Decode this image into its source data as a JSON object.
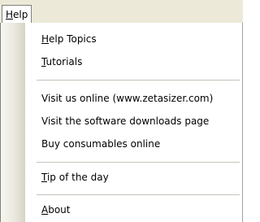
{
  "menu_bar": {
    "title_mnemonic": "H",
    "title_rest": "elp"
  },
  "menu": {
    "items": [
      {
        "mnemonic": "H",
        "rest": "elp Topics"
      },
      {
        "mnemonic": "T",
        "rest": "utorials"
      },
      {
        "mnemonic": "",
        "rest": "Visit us online (www.zetasizer.com)"
      },
      {
        "mnemonic": "",
        "rest": "Visit the software downloads page"
      },
      {
        "mnemonic": "",
        "rest": "Buy consumables online"
      },
      {
        "mnemonic": "T",
        "rest": "ip of the day"
      },
      {
        "mnemonic": "A",
        "rest": "bout"
      }
    ]
  }
}
